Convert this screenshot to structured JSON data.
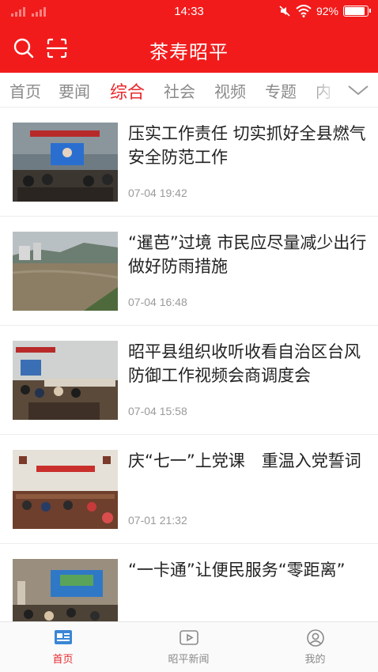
{
  "status_bar": {
    "time": "14:33",
    "battery": "92%",
    "battery_level": 0.92,
    "icons": [
      "signal-icon",
      "signal-icon",
      "mute-icon",
      "wifi-icon",
      "battery-icon"
    ]
  },
  "header": {
    "title": "茶寿昭平",
    "icons": [
      "search-icon",
      "scan-icon"
    ],
    "background": "#f21b1b"
  },
  "tabs": {
    "items": [
      "首页",
      "要闻",
      "综合",
      "社会",
      "视频",
      "专题",
      "内"
    ],
    "active": "综合",
    "active_color": "#e8292e",
    "more_icon": "chevron-down-icon"
  },
  "articles": [
    {
      "headline": "压实工作责任 切实抓好全县燃气安全防范工作",
      "time": "07-04 19:42"
    },
    {
      "headline": "“暹芭”过境 市民应尽量减少出行 做好防雨措施",
      "time": "07-04 16:48"
    },
    {
      "headline": "昭平县组织收听收看自治区台风防御工作视频会商调度会",
      "time": "07-04 15:58"
    },
    {
      "headline": "庆“七一”上党课　重温入党誓词",
      "time": "07-01 21:32"
    },
    {
      "headline": "“一卡通”让便民服务“零距离”",
      "time": ""
    }
  ],
  "bottom_nav": {
    "items": [
      {
        "label": "首页",
        "icon": "news-icon",
        "active": true
      },
      {
        "label": "昭平新闻",
        "icon": "video-play-icon",
        "active": false
      },
      {
        "label": "我的",
        "icon": "user-icon",
        "active": false
      }
    ]
  }
}
